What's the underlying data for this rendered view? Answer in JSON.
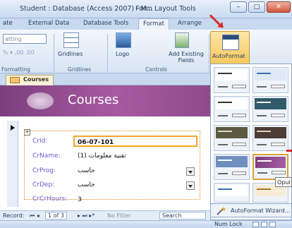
{
  "window": {
    "title": "Student : Database (Access 2007) - M...",
    "context_tab": "Form Layout Tools",
    "min": "–",
    "max": "□",
    "close": "✕"
  },
  "tabs": [
    {
      "label": "ate"
    },
    {
      "label": "External Data"
    },
    {
      "label": "Database Tools"
    },
    {
      "label": "Format",
      "active": true
    },
    {
      "label": "Arrange"
    }
  ],
  "ribbon": {
    "formatting_combo": "atting",
    "formatting_label": "Formatting",
    "gridlines_label": "Gridlines",
    "gridlines_group": "Gridlines",
    "logo_label": "Logo",
    "add_fields_label": "Add Existing Fields",
    "controls_group": "Controls",
    "autoformat_label": "AutoFormat"
  },
  "document_tab": "Courses",
  "form": {
    "header_title": "Courses",
    "fields": [
      {
        "label": "CrId:",
        "value": "06-07-101"
      },
      {
        "label": "CrName:",
        "value": "تقنية معلومات (1)"
      },
      {
        "label": "CrProg:",
        "value": "حاسب"
      },
      {
        "label": "CrDep:",
        "value": "حاسب"
      },
      {
        "label": "CrCrHours:",
        "value": "3"
      }
    ]
  },
  "record_nav": {
    "label": "Record:",
    "position": "1 of 3",
    "filter": "No Filter",
    "search": "Search"
  },
  "gallery": {
    "wizard_label": "AutoFormat Wizard...",
    "tooltip": "Opul"
  },
  "status": {
    "numlock": "Num Lock"
  },
  "colors": {
    "accent": "#f7c453",
    "header": "#8e4c8c",
    "ribbon": "#d7e4f3"
  }
}
